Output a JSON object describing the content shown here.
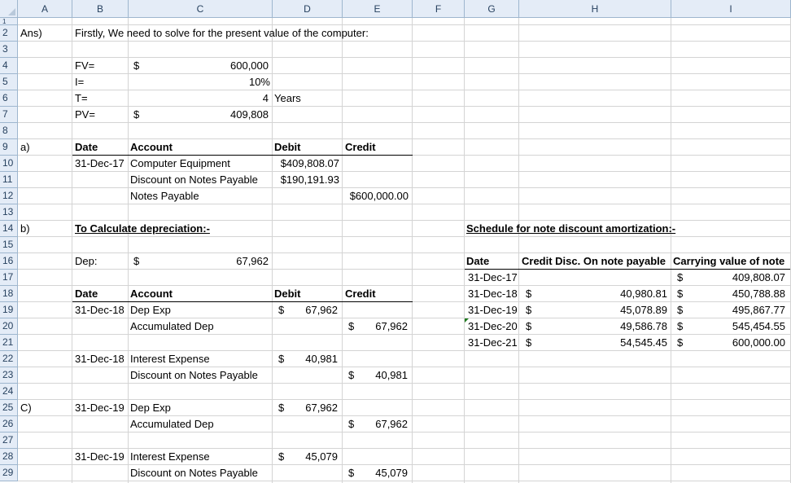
{
  "columns": [
    "A",
    "B",
    "C",
    "D",
    "E",
    "F",
    "G",
    "H",
    "I"
  ],
  "rows": [
    "1",
    "2",
    "3",
    "4",
    "5",
    "6",
    "7",
    "8",
    "9",
    "10",
    "11",
    "12",
    "13",
    "14",
    "15",
    "16",
    "17",
    "18",
    "19",
    "20",
    "21",
    "22",
    "23",
    "24",
    "25",
    "26",
    "27",
    "28",
    "29"
  ],
  "cells": {
    "a2": "Ans)",
    "b2": "Firstly, We need to solve for the present value of the computer:",
    "b4": "FV=",
    "bc4": "$",
    "c4": "600,000",
    "b5": "I=",
    "c5": "10%",
    "b6": "T=",
    "c6": "4",
    "d6": "Years",
    "b7": "PV=",
    "bc7": "$",
    "c7": "409,808",
    "a9": "a)",
    "h_date": "Date",
    "h_account": "Account",
    "h_debit": "Debit",
    "h_credit": "Credit",
    "b10": "31-Dec-17",
    "c10": "Computer Equipment",
    "d10": "$409,808.07",
    "c11": "Discount on Notes Payable",
    "d11": "$190,191.93",
    "c12": "Notes Payable",
    "e12": "$600,000.00",
    "a14": "b)",
    "b14": "To Calculate depreciation:-",
    "g14": "Schedule for note discount amortization:-",
    "b16": "Dep:",
    "bc16": "$",
    "c16": "67,962",
    "b19": "31-Dec-18",
    "c19": "Dep Exp",
    "d19": "67,962",
    "c20": "Accumulated Dep",
    "e20": "67,962",
    "b22": "31-Dec-18",
    "c22": "Interest Expense",
    "d22": "40,981",
    "c23": "Discount on Notes Payable",
    "e23": "40,981",
    "a25": "C)",
    "b25": "31-Dec-19",
    "c25": "Dep Exp",
    "d25": "67,962",
    "c26": "Accumulated Dep",
    "e26": "67,962",
    "b28": "31-Dec-19",
    "c28": "Interest Expense",
    "d28": "45,079",
    "c29": "Discount on Notes Payable",
    "e29": "45,079",
    "dollar": "$"
  },
  "schedule": {
    "headers": [
      "Date",
      "Credit Disc. On note payable",
      "Carrying value of note"
    ],
    "rows": [
      {
        "date": "31-Dec-17",
        "disc": "",
        "carry": "409,808.07"
      },
      {
        "date": "31-Dec-18",
        "disc": "40,980.81",
        "carry": "450,788.88"
      },
      {
        "date": "31-Dec-19",
        "disc": "45,078.89",
        "carry": "495,867.77"
      },
      {
        "date": "31-Dec-20",
        "disc": "49,586.78",
        "carry": "545,454.55"
      },
      {
        "date": "31-Dec-21",
        "disc": "54,545.45",
        "carry": "600,000.00"
      }
    ]
  }
}
